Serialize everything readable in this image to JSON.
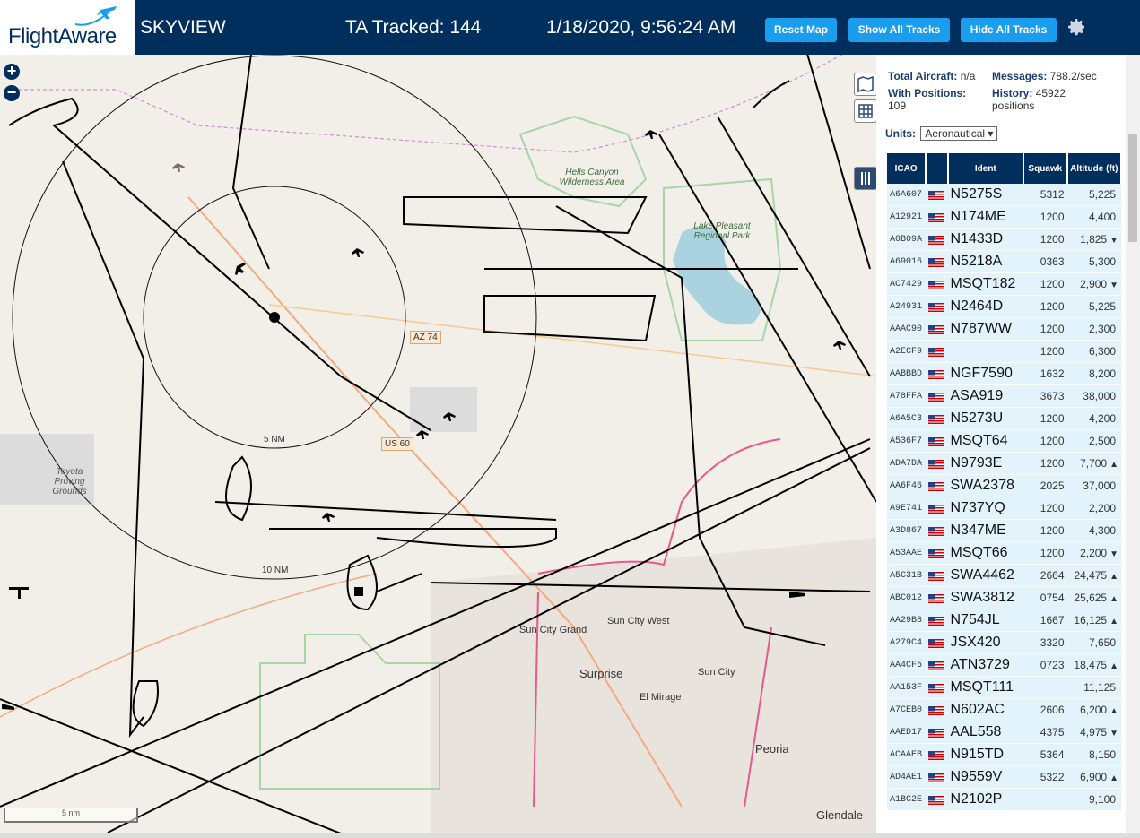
{
  "header": {
    "brand": "FlightAware",
    "app_name": "SKYVIEW",
    "ta_tracked": "TA Tracked: 144",
    "datetime": "1/18/2020, 9:56:24 AM",
    "buttons": {
      "reset": "Reset Map",
      "show_all": "Show All Tracks",
      "hide_all": "Hide All Tracks"
    }
  },
  "map": {
    "labels": {
      "hells": "Hells Canyon Wilderness Area",
      "lake": "Lake Pleasant Regional Park",
      "az74": "AZ 74",
      "us60": "US 60",
      "ring5": "5 NM",
      "ring10": "10 NM",
      "toyota": "Toyota Proving Grounds",
      "suncitygrand": "Sun City Grand",
      "suncitywest": "Sun City West",
      "surprise": "Surprise",
      "suncity": "Sun City",
      "elmirage": "El Mirage",
      "peoria": "Peoria",
      "glendale": "Glendale",
      "scale": "5 nm"
    }
  },
  "panel": {
    "total_aircraft_label": "Total Aircraft:",
    "total_aircraft_value": "n/a",
    "messages_label": "Messages:",
    "messages_value": "788.2/sec",
    "with_positions_label": "With Positions:",
    "with_positions_value": "109",
    "history_label": "History:",
    "history_value": "45922 positions",
    "units_label": "Units:",
    "units_value": "Aeronautical",
    "columns": [
      "ICAO",
      "Ident",
      "Squawk",
      "Altitude (ft)"
    ],
    "rows": [
      {
        "icao": "A6A607",
        "ident": "N5275S",
        "squawk": "5312",
        "alt": "5,225",
        "trend": ""
      },
      {
        "icao": "A12921",
        "ident": "N174ME",
        "squawk": "1200",
        "alt": "4,400",
        "trend": ""
      },
      {
        "icao": "A0B09A",
        "ident": "N1433D",
        "squawk": "1200",
        "alt": "1,825",
        "trend": "▼"
      },
      {
        "icao": "A69016",
        "ident": "N5218A",
        "squawk": "0363",
        "alt": "5,300",
        "trend": ""
      },
      {
        "icao": "AC7429",
        "ident": "MSQT182",
        "squawk": "1200",
        "alt": "2,900",
        "trend": "▼"
      },
      {
        "icao": "A24931",
        "ident": "N2464D",
        "squawk": "1200",
        "alt": "5,225",
        "trend": ""
      },
      {
        "icao": "AAAC90",
        "ident": "N787WW",
        "squawk": "1200",
        "alt": "2,300",
        "trend": ""
      },
      {
        "icao": "A2ECF9",
        "ident": "",
        "squawk": "1200",
        "alt": "6,300",
        "trend": ""
      },
      {
        "icao": "AABBBD",
        "ident": "NGF7590",
        "squawk": "1632",
        "alt": "8,200",
        "trend": ""
      },
      {
        "icao": "A78FFA",
        "ident": "ASA919",
        "squawk": "3673",
        "alt": "38,000",
        "trend": ""
      },
      {
        "icao": "A6A5C3",
        "ident": "N5273U",
        "squawk": "1200",
        "alt": "4,200",
        "trend": ""
      },
      {
        "icao": "A536F7",
        "ident": "MSQT64",
        "squawk": "1200",
        "alt": "2,500",
        "trend": ""
      },
      {
        "icao": "ADA7DA",
        "ident": "N9793E",
        "squawk": "1200",
        "alt": "7,700",
        "trend": "▲"
      },
      {
        "icao": "AA6F46",
        "ident": "SWA2378",
        "squawk": "2025",
        "alt": "37,000",
        "trend": ""
      },
      {
        "icao": "A9E741",
        "ident": "N737YQ",
        "squawk": "1200",
        "alt": "2,200",
        "trend": ""
      },
      {
        "icao": "A3D867",
        "ident": "N347ME",
        "squawk": "1200",
        "alt": "4,300",
        "trend": ""
      },
      {
        "icao": "A53AAE",
        "ident": "MSQT66",
        "squawk": "1200",
        "alt": "2,200",
        "trend": "▼"
      },
      {
        "icao": "A5C31B",
        "ident": "SWA4462",
        "squawk": "2664",
        "alt": "24,475",
        "trend": "▲"
      },
      {
        "icao": "ABC012",
        "ident": "SWA3812",
        "squawk": "0754",
        "alt": "25,625",
        "trend": "▲"
      },
      {
        "icao": "AA29B8",
        "ident": "N754JL",
        "squawk": "1667",
        "alt": "16,125",
        "trend": "▲"
      },
      {
        "icao": "A279C4",
        "ident": "JSX420",
        "squawk": "3320",
        "alt": "7,650",
        "trend": ""
      },
      {
        "icao": "AA4CF5",
        "ident": "ATN3729",
        "squawk": "0723",
        "alt": "18,475",
        "trend": "▲"
      },
      {
        "icao": "AA153F",
        "ident": "MSQT111",
        "squawk": "",
        "alt": "11,125",
        "trend": ""
      },
      {
        "icao": "A7CEB0",
        "ident": "N602AC",
        "squawk": "2606",
        "alt": "6,200",
        "trend": "▲"
      },
      {
        "icao": "AAED17",
        "ident": "AAL558",
        "squawk": "4375",
        "alt": "4,975",
        "trend": "▼"
      },
      {
        "icao": "ACAAEB",
        "ident": "N915TD",
        "squawk": "5364",
        "alt": "8,150",
        "trend": ""
      },
      {
        "icao": "AD4AE1",
        "ident": "N9559V",
        "squawk": "5322",
        "alt": "6,900",
        "trend": "▲"
      },
      {
        "icao": "A1BC2E",
        "ident": "N2102P",
        "squawk": "",
        "alt": "9,100",
        "trend": ""
      }
    ]
  }
}
